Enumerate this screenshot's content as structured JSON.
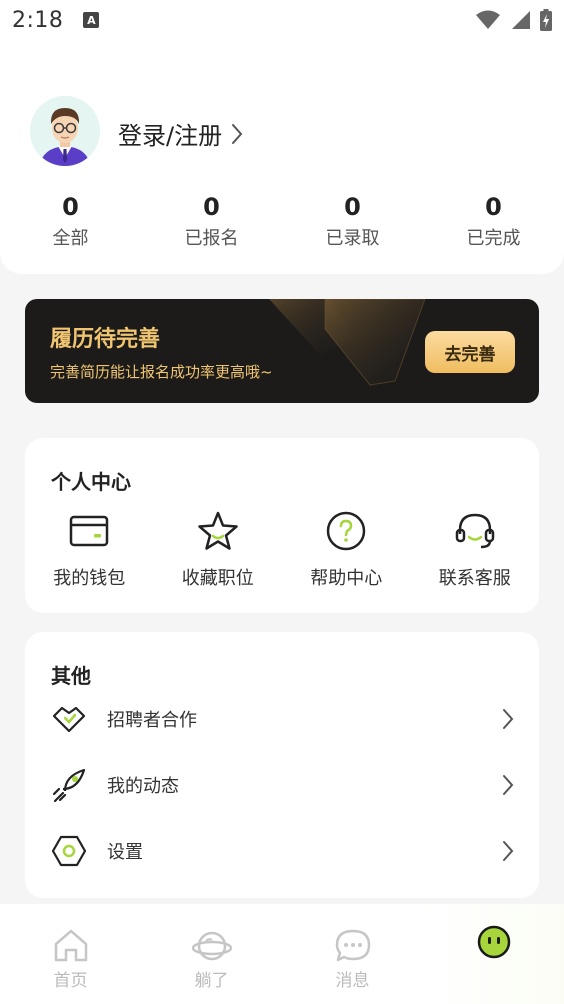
{
  "status_bar": {
    "time": "2:18",
    "notification_badge": "A",
    "icons": [
      "wifi-icon",
      "signal-icon",
      "battery-icon"
    ]
  },
  "profile": {
    "login_label": "登录/注册",
    "stats": [
      {
        "value": "0",
        "label": "全部"
      },
      {
        "value": "0",
        "label": "已报名"
      },
      {
        "value": "0",
        "label": "已录取"
      },
      {
        "value": "0",
        "label": "已完成"
      }
    ]
  },
  "resume_banner": {
    "title": "履历待完善",
    "subtitle": "完善简历能让报名成功率更高哦~",
    "button": "去完善"
  },
  "personal_center": {
    "title": "个人中心",
    "items": [
      {
        "label": "我的钱包",
        "icon": "wallet-icon"
      },
      {
        "label": "收藏职位",
        "icon": "star-icon"
      },
      {
        "label": "帮助中心",
        "icon": "help-icon"
      },
      {
        "label": "联系客服",
        "icon": "headset-icon"
      }
    ]
  },
  "other": {
    "title": "其他",
    "items": [
      {
        "label": "招聘者合作",
        "icon": "handshake-icon"
      },
      {
        "label": "我的动态",
        "icon": "rocket-icon"
      },
      {
        "label": "设置",
        "icon": "settings-icon"
      }
    ]
  },
  "bottom_nav": {
    "items": [
      {
        "label": "首页",
        "icon": "home-icon"
      },
      {
        "label": "躺了",
        "icon": "planet-icon"
      },
      {
        "label": "消息",
        "icon": "message-icon"
      },
      {
        "label": "",
        "icon": "profile-face-icon"
      }
    ]
  },
  "colors": {
    "accent_green": "#a6d63c",
    "gold": "#f0c571",
    "banner_bg": "#1c1b1a"
  }
}
